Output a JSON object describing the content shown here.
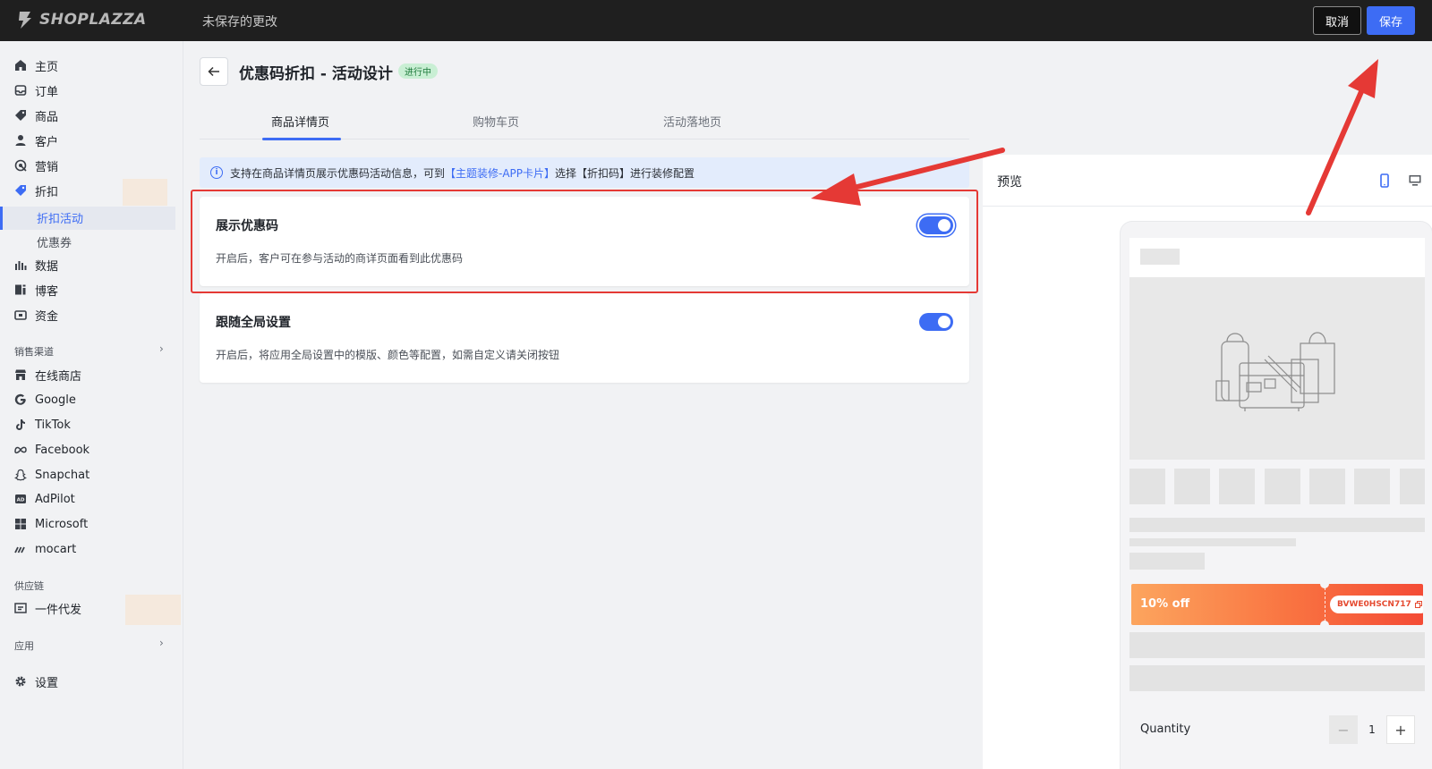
{
  "topbar": {
    "logo_text": "SHOPLAZZA",
    "unsaved_text": "未保存的更改",
    "cancel_label": "取消",
    "save_label": "保存"
  },
  "sidebar": {
    "items": [
      {
        "label": "主页",
        "icon": "home-icon"
      },
      {
        "label": "订单",
        "icon": "inbox-icon"
      },
      {
        "label": "商品",
        "icon": "tag-icon"
      },
      {
        "label": "客户",
        "icon": "person-icon"
      },
      {
        "label": "营销",
        "icon": "target-icon"
      },
      {
        "label": "折扣",
        "icon": "discount-icon"
      }
    ],
    "discount_sub": [
      "折扣活动",
      "优惠券"
    ],
    "items2": [
      {
        "label": "数据",
        "icon": "bar-chart-icon"
      },
      {
        "label": "博客",
        "icon": "blog-icon"
      },
      {
        "label": "资金",
        "icon": "wallet-icon"
      }
    ],
    "sales_channels_label": "销售渠道",
    "channels": [
      {
        "label": "在线商店",
        "icon": "store-icon"
      },
      {
        "label": "Google",
        "icon": "google-icon"
      },
      {
        "label": "TikTok",
        "icon": "tiktok-icon"
      },
      {
        "label": "Facebook",
        "icon": "meta-icon"
      },
      {
        "label": "Snapchat",
        "icon": "snapchat-icon"
      },
      {
        "label": "AdPilot",
        "icon": "adpilot-icon"
      },
      {
        "label": "Microsoft",
        "icon": "microsoft-icon"
      },
      {
        "label": "mocart",
        "icon": "mocart-icon"
      }
    ],
    "supply_chain_label": "供应链",
    "supply_item": "一件代发",
    "apps_label": "应用",
    "settings_label": "设置"
  },
  "header": {
    "title": "优惠码折扣 - 活动设计",
    "status": "进行中"
  },
  "tabs": [
    "商品详情页",
    "购物车页",
    "活动落地页"
  ],
  "info_banner": {
    "prefix": "支持在商品详情页展示优惠码活动信息，可到",
    "link": "【主题装修-APP卡片】",
    "suffix": "选择【折扣码】进行装修配置"
  },
  "cards": [
    {
      "title": "展示优惠码",
      "desc": "开启后，客户可在参与活动的商详页面看到此优惠码",
      "enabled": true
    },
    {
      "title": "跟随全局设置",
      "desc": "开启后，将应用全局设置中的模版、颜色等配置，如需自定义请关闭按钮",
      "enabled": true
    }
  ],
  "preview": {
    "title": "预览",
    "coupon_discount": "10% off",
    "coupon_code": "BVWE0HSCN717",
    "quantity_label": "Quantity",
    "quantity_value": "1",
    "minus": "−",
    "plus": "+"
  },
  "colors": {
    "accent": "#3d6cf4",
    "highlight": "#e53935",
    "topbar": "#1f1f1f"
  }
}
